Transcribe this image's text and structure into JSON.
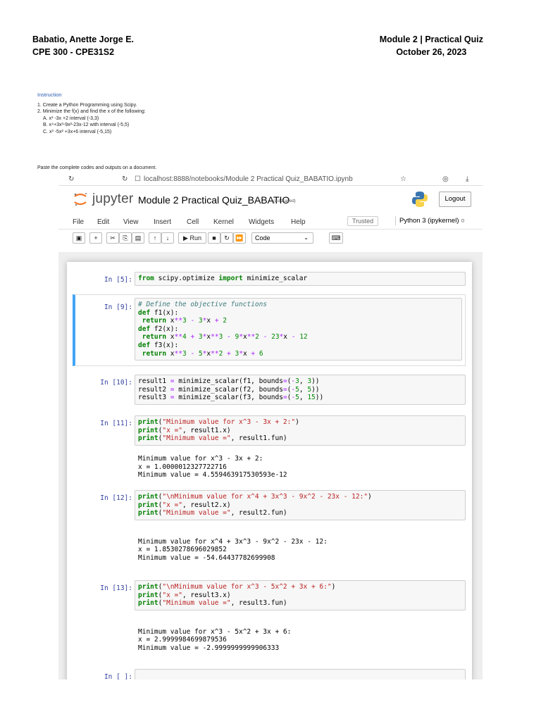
{
  "header": {
    "name": "Babatio, Anette Jorge E.",
    "course": "CPE 300 - CPE31S2",
    "module": "Module 2 | Practical Quiz",
    "date": "October 26, 2023"
  },
  "instruction": {
    "title": "Instruction",
    "items": [
      "1. Create a Python Programming using Scipy.",
      "2. Minimize the f(x) and find the x of the following:",
      "A. x³ -3x +2 interval (-3,3)",
      "B. x⁴+3x³-9x²-23x-12 with interval (-5,5)",
      "C. x³ -5x² +3x+6 interval (-5,15)"
    ],
    "paste_note": "Paste the complete codes and outputs on a document."
  },
  "browser": {
    "url": "localhost:8888/notebooks/Module 2 Practical Quiz_BABATIO.ipynb"
  },
  "jupyter": {
    "logo_text": "jupyter",
    "notebook_name": "Module 2 Practical Quiz_BABATIO",
    "autosave": "(autosaved)",
    "logout": "Logout",
    "menu": [
      "File",
      "Edit",
      "View",
      "Insert",
      "Cell",
      "Kernel",
      "Widgets",
      "Help"
    ],
    "trusted": "Trusted",
    "kernel": "Python 3 (ipykernel)",
    "toolbar": {
      "run": "▶ Run",
      "cell_type": "Code"
    }
  },
  "cells": [
    {
      "prompt": "In [5]:"
    },
    {
      "prompt": "In [9]:"
    },
    {
      "prompt": "In [10]:"
    },
    {
      "prompt": "In [11]:",
      "output": [
        "Minimum value for x^3 - 3x + 2:",
        "x = 1.0000012327722716",
        "Minimum value = 4.559463917530593e-12"
      ]
    },
    {
      "prompt": "In [12]:",
      "output": [
        "",
        "Minimum value for x^4 + 3x^3 - 9x^2 - 23x - 12:",
        "x = 1.8530278696029852",
        "Minimum value = -54.64437782699908"
      ]
    },
    {
      "prompt": "In [13]:",
      "output": [
        "",
        "Minimum value for x^3 - 5x^2 + 3x + 6:",
        "x = 2.9999984699879536",
        "Minimum value = -2.9999999999906333"
      ]
    },
    {
      "prompt": "In [ ]:"
    }
  ]
}
